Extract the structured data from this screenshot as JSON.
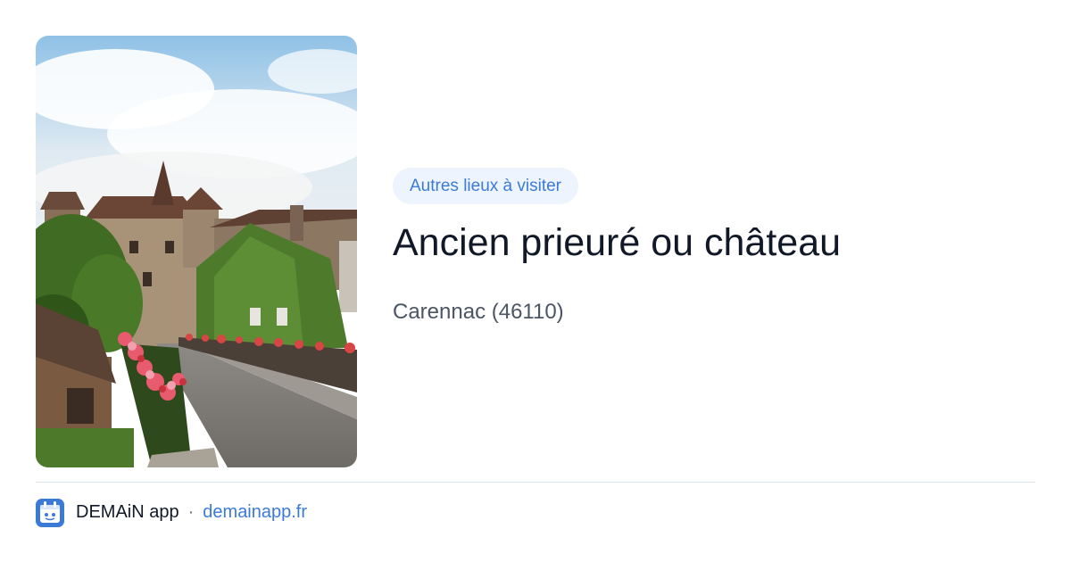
{
  "image": {
    "alt_subject": "village-street-with-castle-and-flower-bridge"
  },
  "category_badge": "Autres lieux à visiter",
  "title": "Ancien prieuré ou château",
  "location": "Carennac (46110)",
  "footer": {
    "app_name": "DEMAiN app",
    "separator": "·",
    "url": "demainapp.fr",
    "icon": "demain-app-logo-icon"
  },
  "colors": {
    "accent": "#3b7bd6",
    "badge_bg": "#eef4fd",
    "title": "#111827",
    "subtitle": "#4b5563",
    "divider": "#dbe3ea"
  }
}
